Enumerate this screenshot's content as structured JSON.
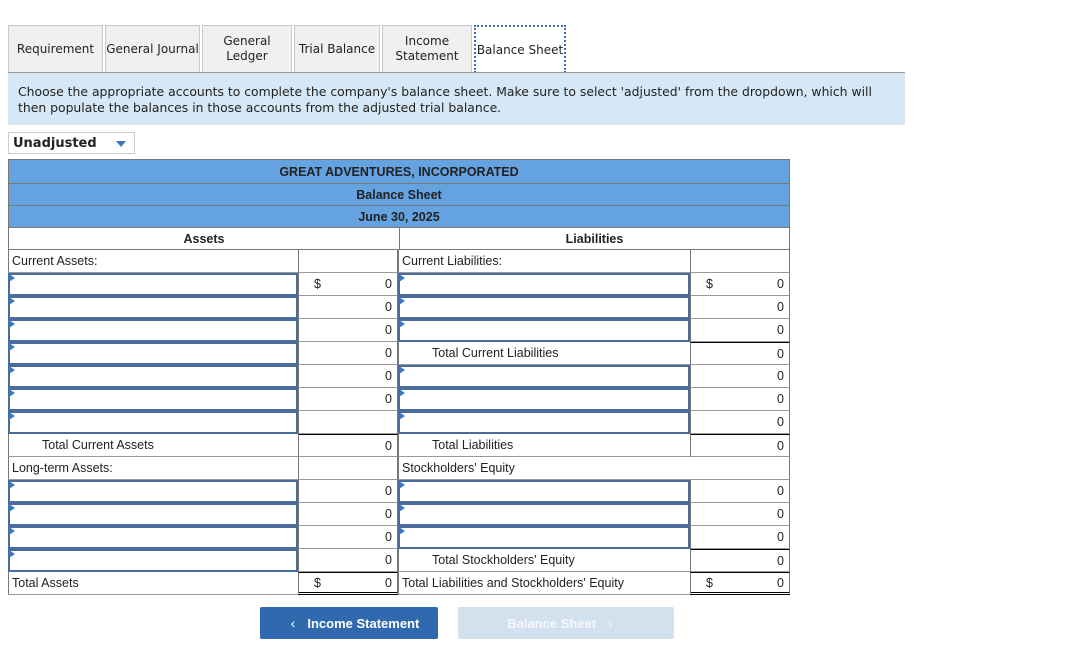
{
  "tabs": [
    {
      "label": "Requirement",
      "width": 95
    },
    {
      "label": "General Journal",
      "width": 95
    },
    {
      "label": "General Ledger",
      "width": 90
    },
    {
      "label": "Trial Balance",
      "width": 86
    },
    {
      "label": "Income Statement",
      "width": 90
    },
    {
      "label": "Balance Sheet",
      "width": 92,
      "active": true
    }
  ],
  "instructions": "Choose the appropriate accounts to complete the company's balance sheet. Make sure to select 'adjusted' from the dropdown, which will then populate the balances in those accounts from the adjusted trial balance.",
  "dropdown": {
    "selected": "Unadjusted"
  },
  "sheet": {
    "company": "GREAT ADVENTURES, INCORPORATED",
    "title": "Balance Sheet",
    "date": "June 30, 2025",
    "assets_header": "Assets",
    "liabilities_header": "Liabilities",
    "assets_rows": [
      {
        "type": "label",
        "label": "Current Assets:"
      },
      {
        "type": "input",
        "currency": "$",
        "amount": "0"
      },
      {
        "type": "input",
        "amount": "0"
      },
      {
        "type": "input",
        "amount": "0"
      },
      {
        "type": "input",
        "amount": "0"
      },
      {
        "type": "input",
        "amount": "0"
      },
      {
        "type": "input",
        "amount": "0"
      },
      {
        "type": "input",
        "amount": ""
      },
      {
        "type": "total",
        "label": "Total Current Assets",
        "amount": "0",
        "indent": true
      },
      {
        "type": "label",
        "label": "Long-term Assets:"
      },
      {
        "type": "input",
        "amount": "0"
      },
      {
        "type": "input",
        "amount": "0"
      },
      {
        "type": "input",
        "amount": "0"
      },
      {
        "type": "input",
        "amount": "0"
      },
      {
        "type": "grand",
        "label": "Total Assets",
        "currency": "$",
        "amount": "0"
      }
    ],
    "liabilities_rows": [
      {
        "type": "label",
        "label": "Current Liabilities:"
      },
      {
        "type": "input",
        "currency": "$",
        "amount": "0"
      },
      {
        "type": "input",
        "amount": "0"
      },
      {
        "type": "input",
        "amount": "0"
      },
      {
        "type": "total",
        "label": "Total Current Liabilities",
        "amount": "0",
        "indent": true
      },
      {
        "type": "input",
        "amount": "0"
      },
      {
        "type": "input",
        "amount": "0"
      },
      {
        "type": "input",
        "amount": "0"
      },
      {
        "type": "total",
        "label": "Total Liabilities",
        "amount": "0",
        "indent": true
      },
      {
        "type": "label",
        "label": "Stockholders' Equity",
        "noamt": true
      },
      {
        "type": "input",
        "amount": "0"
      },
      {
        "type": "input",
        "amount": "0"
      },
      {
        "type": "input",
        "amount": "0"
      },
      {
        "type": "total",
        "label": "Total Stockholders' Equity",
        "amount": "0",
        "indent": true
      },
      {
        "type": "grand",
        "label": "Total Liabilities and Stockholders' Equity",
        "currency": "$",
        "amount": "0"
      }
    ]
  },
  "nav": {
    "prev_label": "Income Statement",
    "next_label": "Balance Sheet",
    "prev_icon": "chevron-left-icon",
    "next_icon": "chevron-right-icon"
  }
}
